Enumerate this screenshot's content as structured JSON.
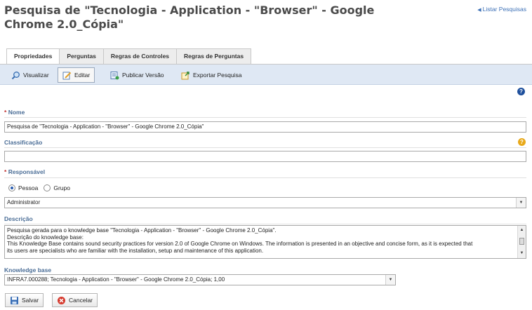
{
  "header": {
    "title": "Pesquisa de \"Tecnologia - Application - \"Browser\" - Google Chrome 2.0_Cópia\"",
    "list_link": "Listar Pesquisas"
  },
  "tabs": [
    {
      "label": "Propriedades",
      "active": true
    },
    {
      "label": "Perguntas",
      "active": false
    },
    {
      "label": "Regras de Controles",
      "active": false
    },
    {
      "label": "Regras de Perguntas",
      "active": false
    }
  ],
  "toolbar": {
    "visualizar": "Visualizar",
    "editar": "Editar",
    "publicar": "Publicar Versão",
    "exportar": "Exportar Pesquisa"
  },
  "form": {
    "nome_label": "Nome",
    "nome_value": "Pesquisa de \"Tecnologia - Application - \"Browser\" - Google Chrome 2.0_Cópia\"",
    "classificacao_label": "Classificação",
    "classificacao_value": "",
    "responsavel_label": "Responsável",
    "pessoa_label": "Pessoa",
    "grupo_label": "Grupo",
    "responsavel_selected": "pessoa",
    "responsavel_value": "Administrator",
    "descricao_label": "Descrição",
    "descricao_lines": [
      "Pesquisa gerada para o knowledge base \"Tecnologia - Application - \"Browser\" - Google Chrome 2.0_Cópia\".",
      "Descrição do knowledge base:",
      "This Knowledge Base contains sound security practices for version 2.0 of Google Chrome on Windows. The information is presented in an objective and concise form, as it is expected that",
      "its users are specialists who are familiar with the installation, setup and maintenance of this application."
    ],
    "kb_label": "Knowledge base",
    "kb_value": "INFRA7.000288; Tecnologia - Application - \"Browser\" - Google Chrome 2.0_Cópia; 1,00"
  },
  "actions": {
    "salvar": "Salvar",
    "cancelar": "Cancelar"
  },
  "colors": {
    "label": "#4a6d96",
    "toolbar_bg": "#dfe8f4",
    "link": "#3b6fb6"
  }
}
